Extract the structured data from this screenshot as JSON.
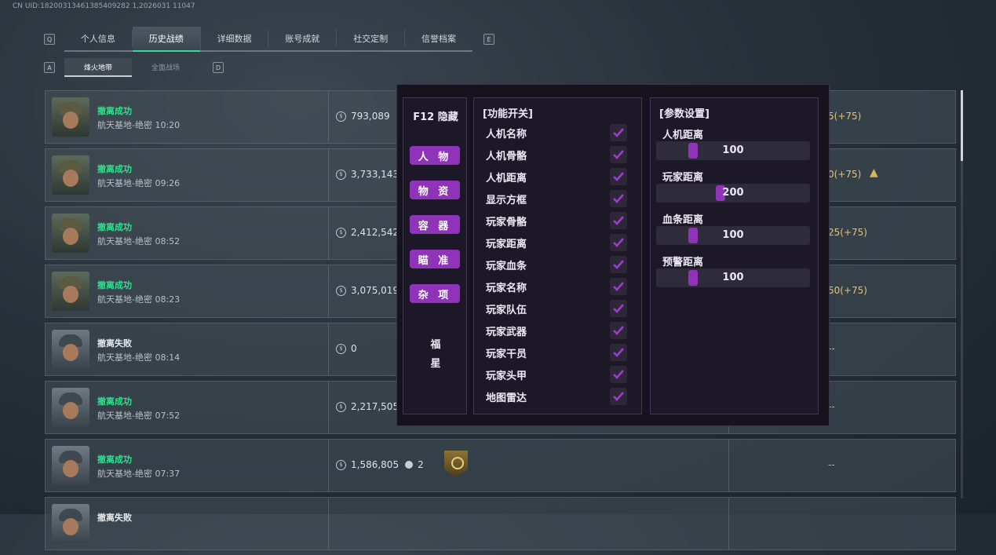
{
  "uid": "CN UID:18200313461385409282 1,2026031 11047",
  "tabs": [
    {
      "label": "个人信息",
      "active": false
    },
    {
      "label": "历史战绩",
      "active": true
    },
    {
      "label": "详细数据",
      "active": false
    },
    {
      "label": "账号成就",
      "active": false
    },
    {
      "label": "社交定制",
      "active": false
    },
    {
      "label": "信誉档案",
      "active": false
    }
  ],
  "tab_keys": {
    "left": "Q",
    "right": "E",
    "sub_left": "A",
    "sub_right": "D"
  },
  "subtabs": [
    {
      "label": "烽火地带",
      "active": true
    },
    {
      "label": "全面战场",
      "active": false
    }
  ],
  "matches": [
    {
      "status": "撤离成功",
      "result": "success",
      "location": "航天基地-绝密 10:20",
      "money": "793,089",
      "score": "5(+75)",
      "rank": false
    },
    {
      "status": "撤离成功",
      "result": "success",
      "location": "航天基地-绝密 09:26",
      "money": "3,733,143",
      "score": "0(+75)",
      "rank": true
    },
    {
      "status": "撤离成功",
      "result": "success",
      "location": "航天基地-绝密 08:52",
      "money": "2,412,542",
      "score": "25(+75)",
      "rank": false
    },
    {
      "status": "撤离成功",
      "result": "success",
      "location": "航天基地-绝密 08:23",
      "money": "3,075,019",
      "score": "50(+75)",
      "rank": false
    },
    {
      "status": "撤离失败",
      "result": "fail",
      "location": "航天基地-绝密 08:14",
      "money": "0",
      "score": "--",
      "rank": false
    },
    {
      "status": "撤离成功",
      "result": "success",
      "location": "航天基地-绝密 07:52",
      "money": "2,217,505",
      "score": "--",
      "rank": false
    },
    {
      "status": "撤离成功",
      "result": "success",
      "location": "航天基地-绝密 07:37",
      "money": "1,586,805",
      "kills": "2",
      "score": "--",
      "rank": false
    },
    {
      "status": "撤离失败",
      "result": "fail",
      "location": "",
      "money": "",
      "score": "",
      "rank": false
    }
  ],
  "menu": {
    "hide_label": "F12 隐藏",
    "categories": [
      "人 物",
      "物 资",
      "容 器",
      "瞄 准",
      "杂 项"
    ],
    "footer_chars": [
      "福",
      "星"
    ],
    "features_title": "[功能开关]",
    "features": [
      {
        "label": "人机名称",
        "checked": true
      },
      {
        "label": "人机骨骼",
        "checked": true
      },
      {
        "label": "人机距离",
        "checked": true
      },
      {
        "label": "显示方框",
        "checked": true
      },
      {
        "label": "玩家骨骼",
        "checked": true
      },
      {
        "label": "玩家距离",
        "checked": true
      },
      {
        "label": "玩家血条",
        "checked": true
      },
      {
        "label": "玩家名称",
        "checked": true
      },
      {
        "label": "玩家队伍",
        "checked": true
      },
      {
        "label": "玩家武器",
        "checked": true
      },
      {
        "label": "玩家干员",
        "checked": true
      },
      {
        "label": "玩家头甲",
        "checked": true
      },
      {
        "label": "地图雷达",
        "checked": true
      }
    ],
    "params_title": "[参数设置]",
    "params": [
      {
        "label": "人机距离",
        "value": "100",
        "fraction": 0.21
      },
      {
        "label": "玩家距离",
        "value": "200",
        "fraction": 0.39
      },
      {
        "label": "血条距离",
        "value": "100",
        "fraction": 0.21
      },
      {
        "label": "预警距离",
        "value": "100",
        "fraction": 0.21
      }
    ]
  },
  "colors": {
    "accent": "#8f33b8",
    "success": "#2ee28e",
    "tab_underline": "#2ddc9f",
    "score": "#e0c27a"
  }
}
